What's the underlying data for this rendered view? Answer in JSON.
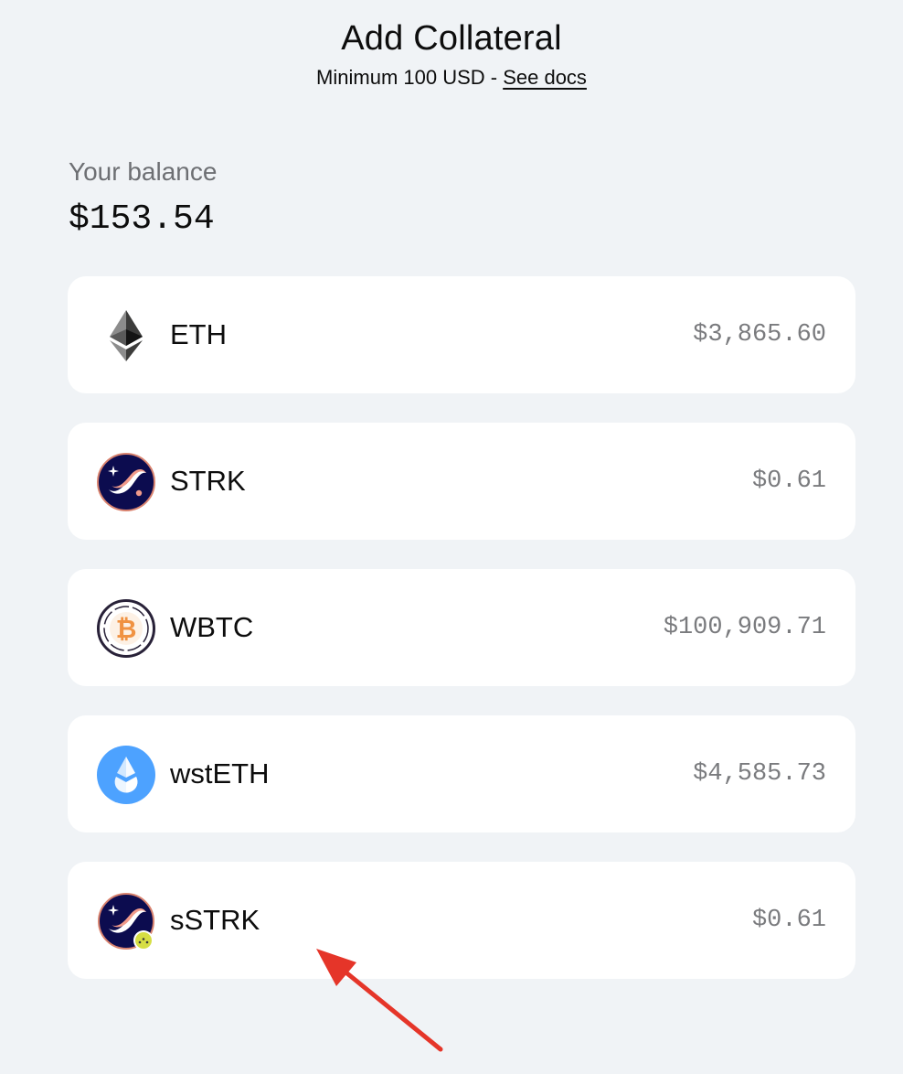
{
  "header": {
    "title": "Add Collateral",
    "subtitle_prefix": "Minimum 100 USD - ",
    "docs_link": "See docs"
  },
  "balance": {
    "label": "Your balance",
    "value": "$153.54"
  },
  "assets": [
    {
      "name": "ETH",
      "value": "$3,865.60",
      "icon": "eth-icon"
    },
    {
      "name": "STRK",
      "value": "$0.61",
      "icon": "strk-icon"
    },
    {
      "name": "WBTC",
      "value": "$100,909.71",
      "icon": "wbtc-icon"
    },
    {
      "name": "wstETH",
      "value": "$4,585.73",
      "icon": "wsteth-icon"
    },
    {
      "name": "sSTRK",
      "value": "$0.61",
      "icon": "sstrk-icon"
    }
  ],
  "colors": {
    "background": "#f0f3f6",
    "card": "#ffffff",
    "annotation_arrow": "#e53529"
  }
}
